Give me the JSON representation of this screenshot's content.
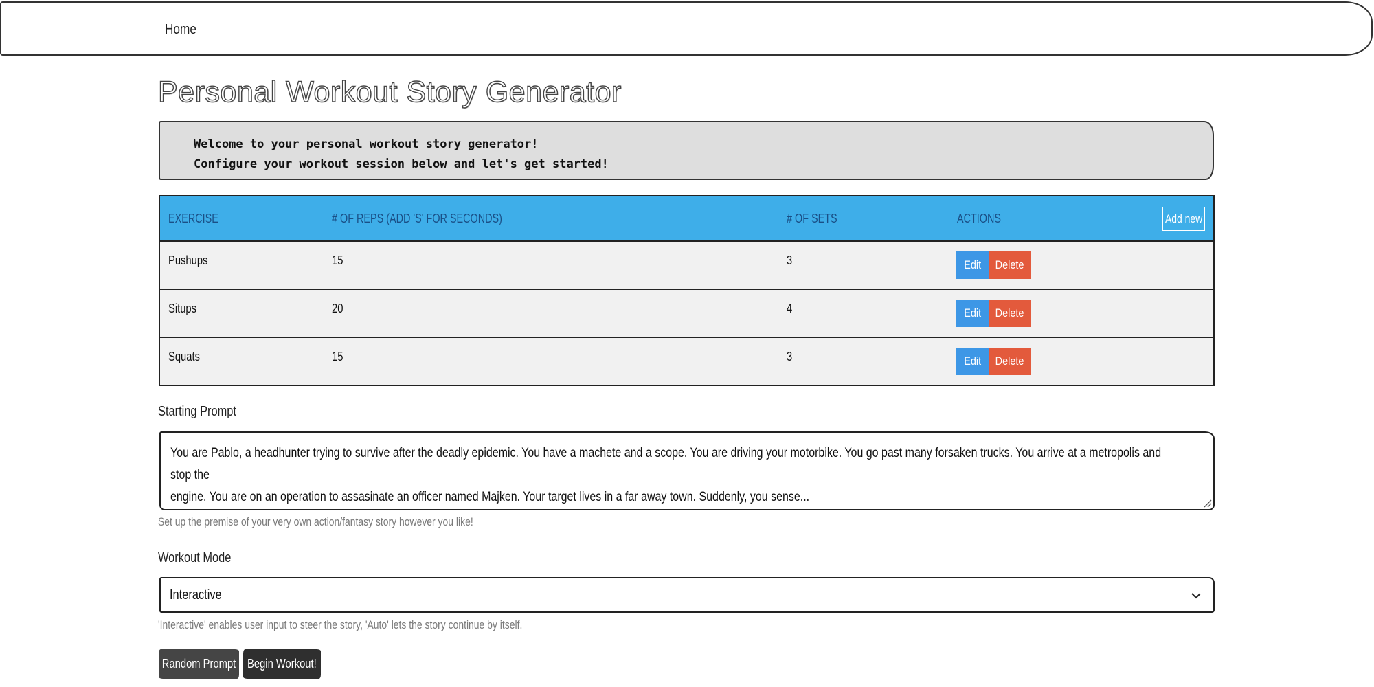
{
  "nav": {
    "home": "Home"
  },
  "page": {
    "title": "Personal Workout Story Generator",
    "welcome_line1": "Welcome to your personal workout story generator!",
    "welcome_line2": "Configure your workout session below and let's get started!"
  },
  "table": {
    "headers": [
      "Exercise",
      "# of Reps (add 's' for seconds)",
      "# of Sets",
      "Actions"
    ],
    "add_new_label": "Add new",
    "edit_label": "Edit",
    "delete_label": "Delete",
    "rows": [
      {
        "exercise": "Pushups",
        "reps": "15",
        "sets": "3"
      },
      {
        "exercise": "Situps",
        "reps": "20",
        "sets": "4"
      },
      {
        "exercise": "Squats",
        "reps": "15",
        "sets": "3"
      }
    ]
  },
  "prompt": {
    "label": "Starting Prompt",
    "value_line1": "You are Pablo, a headhunter trying to survive after the deadly epidemic. You have a machete and a scope. You are driving your motorbike. You go past many forsaken trucks. You arrive at a metropolis and stop the",
    "value_line2": "engine. You are on an operation to assasinate an officer named Majken. Your target lives in a far away town.  Suddenly, you sense...",
    "hint": "Set up the premise of your very own action/fantasy story however you like!"
  },
  "mode": {
    "label": "Workout Mode",
    "selected": "Interactive",
    "hint": "'Interactive' enables user input to steer the story, 'Auto' lets the story continue by itself."
  },
  "buttons": {
    "random_prompt": "Random Prompt",
    "begin_workout": "Begin Workout!"
  },
  "colors": {
    "table_header": "#3eaee9",
    "edit": "#3d97e6",
    "delete": "#e35a3c",
    "dark_button": "#3a3a3a"
  }
}
